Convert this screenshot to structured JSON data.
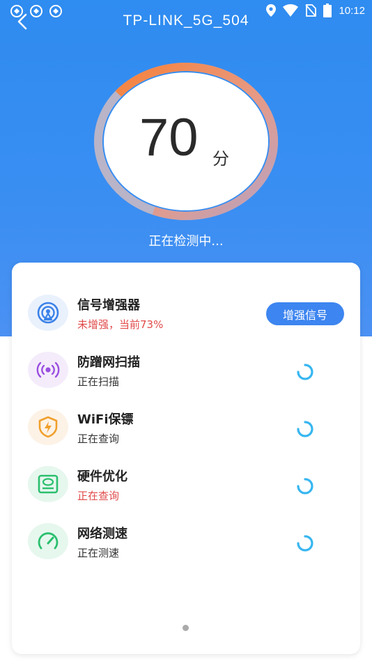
{
  "status_bar": {
    "time": "10:12",
    "left_icons": [
      "app-notification-icon",
      "app-notification-icon",
      "app-notification-icon"
    ],
    "right_icons": [
      "location-icon",
      "wifi-icon",
      "no-sim-icon",
      "battery-icon"
    ]
  },
  "header": {
    "title": "TP-LINK_5G_504",
    "back_icon": "chevron-left-icon"
  },
  "score": {
    "value": "70",
    "unit": "分",
    "progress": 0.7,
    "status_text": "正在检测中..."
  },
  "items": [
    {
      "title": "信号增强器",
      "status": "未增强，当前73%",
      "status_color": "#e14a4a",
      "icon": "signal-booster-icon",
      "icon_bg": "#e9f1fd",
      "icon_color": "#3b82e8",
      "action_label": "增强信号"
    },
    {
      "title": "防蹭网扫描",
      "status": "正在扫描",
      "icon": "broadcast-scan-icon",
      "icon_bg": "#f4ecfb",
      "icon_color": "#9b4fe0"
    },
    {
      "title": "WiFi保镖",
      "status": "正在查询",
      "icon": "shield-lightning-icon",
      "icon_bg": "#fdf2e6",
      "icon_color": "#f0a02c"
    },
    {
      "title": "硬件优化",
      "status": "正在查询",
      "status_color": "#e14a4a",
      "icon": "hardware-drive-icon",
      "icon_bg": "#e6f7ee",
      "icon_color": "#2bbf6e"
    },
    {
      "title": "网络测速",
      "status": "正在测速",
      "icon": "speedometer-icon",
      "icon_bg": "#e6f7ee",
      "icon_color": "#2bbf6e"
    }
  ],
  "colors": {
    "header_blue": "#2f8cf0",
    "button_blue": "#3d85f0",
    "ring_orange": "#f0874a",
    "ring_gray": "#b9b4c8",
    "spinner_cyan": "#37b6f0"
  },
  "pager": {
    "pages": 1,
    "current": 1
  }
}
